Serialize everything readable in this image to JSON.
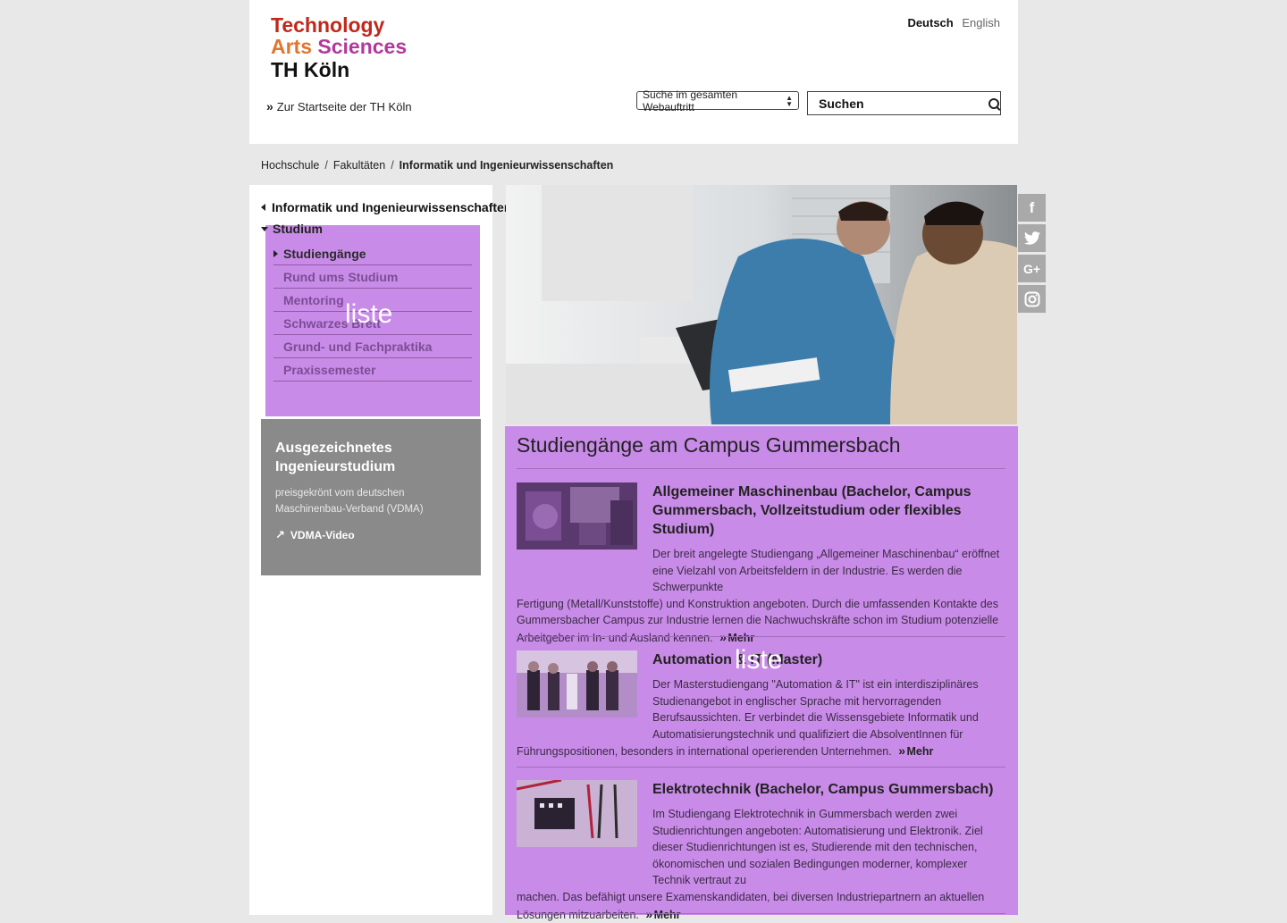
{
  "header": {
    "logo": {
      "line1": "Technology",
      "line2a": "Arts",
      "line2b": "Sciences",
      "line3": "TH Köln"
    },
    "languages": [
      "Deutsch",
      "English"
    ],
    "home_link": "Zur Startseite der TH Köln",
    "search_scope": "Suche im gesamten Webauftritt",
    "search_placeholder": "Suchen"
  },
  "breadcrumb": [
    "Hochschule",
    "Fakultäten",
    "Informatik und Ingenieurwissenschaften"
  ],
  "sidebar": {
    "parent": "Informatik und Ingenieurwissenschaften",
    "section": "Studium",
    "items": [
      {
        "label": "Studiengänge",
        "active": true
      },
      {
        "label": "Rund ums Studium"
      },
      {
        "label": "Mentoring"
      },
      {
        "label": "Schwarzes Brett"
      },
      {
        "label": "Grund- und Fachpraktika"
      },
      {
        "label": "Praxissemester"
      }
    ],
    "overlay_label": "liste",
    "promo": {
      "title": "Ausgezeichnetes Ingenieurstudium",
      "text": "preisgekrönt vom deutschen Maschinenbau-Verband (VDMA)",
      "link": "VDMA-Video"
    }
  },
  "content": {
    "title": "Studiengänge am Campus Gummersbach",
    "overlay_label": "liste",
    "more_label": "Mehr",
    "entries": [
      {
        "title": "Allgemeiner Maschinenbau (Bachelor, Campus Gummersbach, Vollzeitstudium oder flexibles Studium)",
        "text_indented": "Der breit angelegte Studiengang „Allgemeiner Maschinenbau“ eröffnet eine Vielzahl von Arbeitsfeldern in der Industrie. Es werden die Schwerpunkte",
        "text_full": "Fertigung (Metall/Kunststoffe) und Konstruktion angeboten. Durch die umfassenden Kontakte des Gummersbacher Campus zur Industrie lernen die Nachwuchskräfte schon im Studium potenzielle Arbeitgeber im In- und Ausland kennen."
      },
      {
        "title": "Automation & IT (Master)",
        "text_indented": "Der Masterstudiengang \"Automation & IT\" ist ein interdisziplinäres Studienangebot in englischer Sprache mit hervorragenden Berufsaussichten. Er verbindet die Wissensgebiete Informatik und Automatisierungstechnik und qualifiziert die AbsolventInnen für",
        "text_full": "Führungspositionen, besonders in international operierenden Unternehmen."
      },
      {
        "title": "Elektrotechnik (Bachelor, Campus Gummersbach)",
        "text_indented": "Im Studiengang Elektrotechnik in Gummersbach werden zwei Studienrichtungen angeboten: Automatisierung und Elektronik. Ziel dieser Studienrichtungen ist es, Studierende mit den technischen, ökonomischen und sozialen Bedingungen moderner, komplexer Technik vertraut zu",
        "text_full": "machen. Das befähigt unsere Examenskandidaten, bei diversen Industriepartnern an aktuellen Lösungen mitzuarbeiten."
      }
    ]
  },
  "social": [
    {
      "icon": "facebook-icon",
      "glyph": "f"
    },
    {
      "icon": "twitter-icon",
      "glyph": "t"
    },
    {
      "icon": "google-plus-icon",
      "glyph": "G+"
    },
    {
      "icon": "instagram-icon",
      "glyph": "◎"
    }
  ]
}
